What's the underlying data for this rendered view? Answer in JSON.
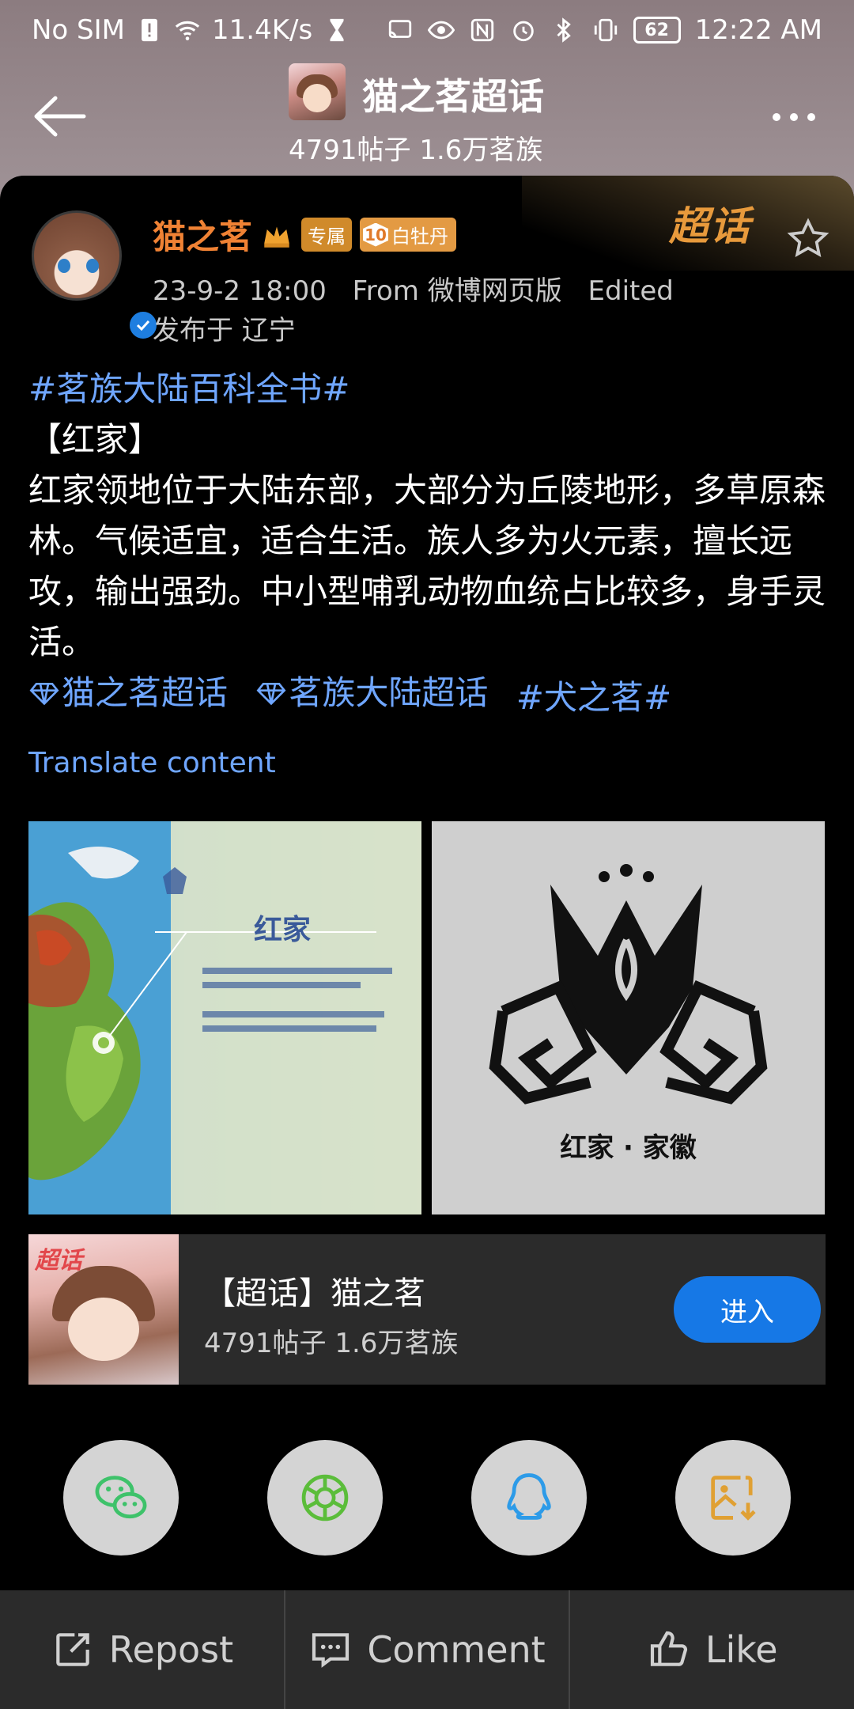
{
  "status_bar": {
    "carrier": "No SIM",
    "net_speed": "11.4K/s",
    "battery": "62",
    "time": "12:22 AM"
  },
  "header": {
    "topic_title": "猫之茗超话",
    "topic_stats": "4791帖子 1.6万茗族"
  },
  "post": {
    "supertopic_label": "超话",
    "author": "猫之茗",
    "tag_exclusive": "专属",
    "fan_level": "10",
    "fan_badge": "白牡丹",
    "date": "23-9-2 18:00",
    "source": "From 微博网页版",
    "edited": "Edited",
    "location": "发布于 辽宁",
    "hashtag_main": "#茗族大陆百科全书#",
    "section_title": "【红家】",
    "body": "红家领地位于大陆东部，大部分为丘陵地形，多草原森林。气候适宜，适合生活。族人多为火元素，擅长远攻，输出强劲。中小型哺乳动物血统占比较多，身手灵活。",
    "topic_link_1": "猫之茗超话",
    "topic_link_2": "茗族大陆超话",
    "hashtag_end": "#犬之茗#",
    "translate": "Translate content",
    "image_left_title": "红家",
    "image_right_caption": "红家 · 家徽"
  },
  "topic_card": {
    "thumb_logo": "超话",
    "title": "【超话】猫之茗",
    "stats": "4791帖子 1.6万茗族",
    "enter": "进入"
  },
  "share": {
    "icons": [
      "wechat-icon",
      "moments-icon",
      "qq-icon",
      "save-image-icon"
    ],
    "colors": {
      "wechat": "#3ec26a",
      "moments": "#5bbd3a",
      "qq": "#2d9be8",
      "save": "#e0a033"
    }
  },
  "actions": {
    "repost": "Repost",
    "comment": "Comment",
    "like": "Like"
  },
  "colors": {
    "accent_blue": "#6fa6ff",
    "author_orange": "#f08234",
    "enter_button": "#1678e6"
  }
}
